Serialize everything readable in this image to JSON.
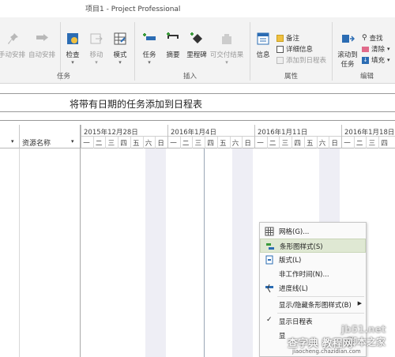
{
  "window": {
    "title": "项目1 - Project Professional"
  },
  "ribbon": {
    "buttons": {
      "manual": "手动安排",
      "auto": "自动安排",
      "inspect": "检查",
      "move": "移动",
      "mode": "模式",
      "task": "任务",
      "summary": "摘要",
      "milestone": "里程碑",
      "deliverable": "可交付结果",
      "info": "信息",
      "scroll1": "滚动到",
      "scroll2": "任务"
    },
    "small": {
      "notes": "备注",
      "details": "详细信息",
      "add_timeline": "添加到日程表",
      "find": "查找",
      "clear": "清除",
      "fill": "填充"
    },
    "groups": {
      "tasks": "任务",
      "insert": "插入",
      "properties": "属性",
      "editing": "编辑"
    }
  },
  "task_title": "将带有日期的任务添加到日程表",
  "gantt": {
    "resource_header": "资源名称",
    "weeks": [
      "2015年12月28日",
      "2016年1月4日",
      "2016年1月11日",
      "2016年1月18日"
    ],
    "days": [
      "一",
      "二",
      "三",
      "四",
      "五",
      "六",
      "日"
    ]
  },
  "context_menu": {
    "items": [
      {
        "label": "网格(G)...",
        "icon": "grid-icon"
      },
      {
        "label": "条形图样式(S)",
        "icon": "bar-style-icon",
        "highlighted": true
      },
      {
        "label": "版式(L)",
        "icon": "layout-icon"
      },
      {
        "label": "非工作时间(N)...",
        "icon": ""
      },
      {
        "label": "进度线(L)",
        "icon": "progress-line-icon"
      },
      {
        "label": "显示/隐藏条形图样式(B)",
        "icon": "",
        "submenu": true
      },
      {
        "label": "显示日程表",
        "icon": "check-icon"
      },
      {
        "label": "显",
        "icon": ""
      }
    ]
  },
  "watermark": {
    "site": "jb51.net",
    "text": "脚本之家",
    "text2": "查字典 教程网",
    "url": "jiaocheng.chazidian.com"
  },
  "colors": {
    "ribbon_bg": "#f3f3f3",
    "menu_highlight": "#dfe8d3",
    "weekend_shade": "#eeeef5",
    "accent_blue": "#2b6cb3",
    "accent_green": "#3a9a3a"
  }
}
